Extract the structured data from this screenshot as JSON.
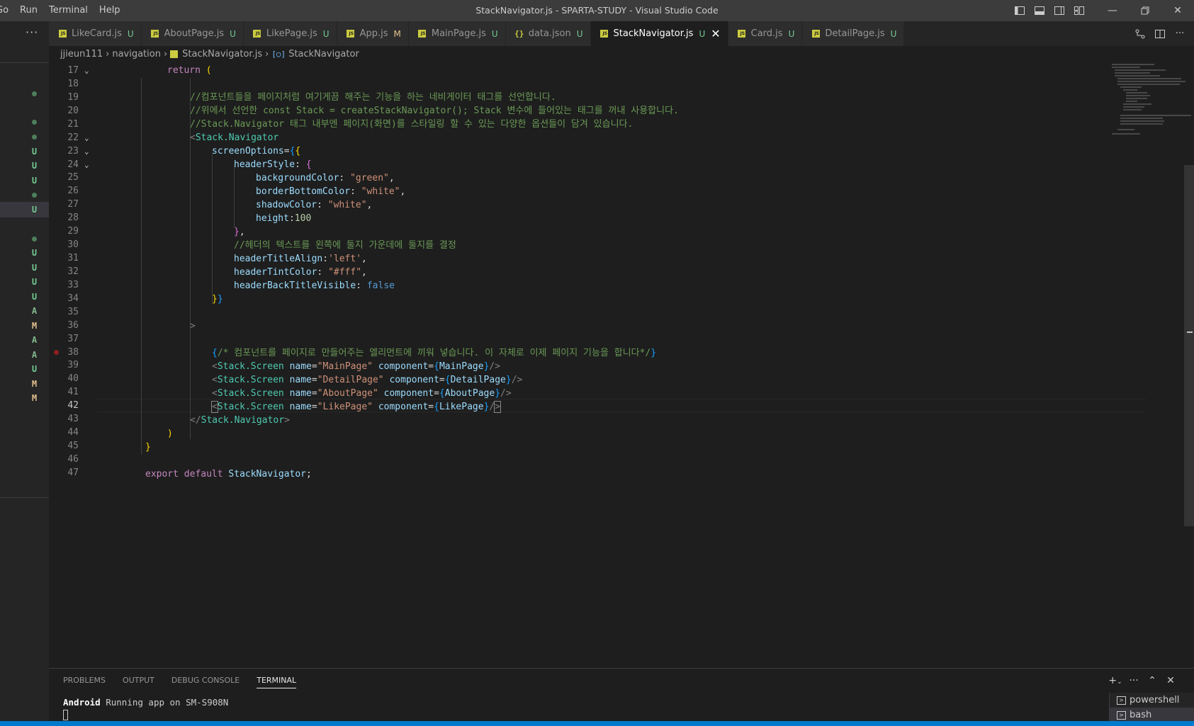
{
  "menu": [
    "Go",
    "Run",
    "Terminal",
    "Help"
  ],
  "window_title": "StackNavigator.js - SPARTA-STUDY - Visual Studio Code",
  "tabs": [
    {
      "label": "LikeCard.js",
      "status": "U",
      "icon": "js-icon"
    },
    {
      "label": "AboutPage.js",
      "status": "U",
      "icon": "js-icon"
    },
    {
      "label": "LikePage.js",
      "status": "U",
      "icon": "js-icon"
    },
    {
      "label": "App.js",
      "status": "M",
      "icon": "js-icon"
    },
    {
      "label": "MainPage.js",
      "status": "U",
      "icon": "js-icon"
    },
    {
      "label": "data.json",
      "status": "U",
      "icon": "json-icon"
    },
    {
      "label": "StackNavigator.js",
      "status": "U",
      "icon": "js-icon",
      "active": true
    },
    {
      "label": "Card.js",
      "status": "U",
      "icon": "js-icon"
    },
    {
      "label": "DetailPage.js",
      "status": "U",
      "icon": "js-icon"
    }
  ],
  "breadcrumb": {
    "root": "jjieun111",
    "folder": "navigation",
    "file": "StackNavigator.js",
    "symbol": "StackNavigator"
  },
  "scm_badges": [
    "dot",
    "dot",
    "dot",
    "U",
    "U",
    "U",
    "dot",
    "U",
    "dot",
    "U",
    "U",
    "U",
    "U",
    "A",
    "M",
    "A",
    "A",
    "U",
    "M",
    "M"
  ],
  "editor": {
    "current_line": 42,
    "breakpoint_line": 38,
    "lines": [
      {
        "n": "17",
        "fold": true
      },
      {
        "n": "18"
      },
      {
        "n": "19",
        "text": "//컴포넌트들을 페이지처럼 여기게끔 해주는 기능을 하는 네비게이터 태그를 선언합니다."
      },
      {
        "n": "20",
        "text": "//위에서 선언한 const Stack = createStackNavigator(); Stack 변수에 들어있는 태그를 꺼내 사용합니다."
      },
      {
        "n": "21",
        "text": "//Stack.Navigator 태그 내부엔 페이지(화면)를 스타일링 할 수 있는 다양한 옵션들이 담겨 있습니다."
      },
      {
        "n": "22",
        "fold": true
      },
      {
        "n": "23",
        "fold": true
      },
      {
        "n": "24",
        "fold": true
      },
      {
        "n": "25"
      },
      {
        "n": "26"
      },
      {
        "n": "27"
      },
      {
        "n": "28"
      },
      {
        "n": "29"
      },
      {
        "n": "30",
        "text": "//헤더의 텍스트를 왼쪽에 둘지 가운데에 둘지를 결정"
      },
      {
        "n": "31"
      },
      {
        "n": "32"
      },
      {
        "n": "33"
      },
      {
        "n": "34"
      },
      {
        "n": "35"
      },
      {
        "n": "36"
      },
      {
        "n": "37"
      },
      {
        "n": "38",
        "text": "/* 컴포넌트를 페이지로 만들어주는 엘리먼트에 끼워 넣습니다. 이 자체로 이제 페이지 기능을 합니다*/"
      },
      {
        "n": "39"
      },
      {
        "n": "40"
      },
      {
        "n": "41"
      },
      {
        "n": "42"
      },
      {
        "n": "43"
      },
      {
        "n": "44"
      },
      {
        "n": "45"
      },
      {
        "n": "46"
      },
      {
        "n": "47"
      }
    ],
    "tokens": {
      "return_kw": "return",
      "stack_navigator_tag": "Stack.Navigator",
      "screen_options": "screenOptions",
      "header_style": "headerStyle",
      "background_color_key": "backgroundColor",
      "background_color_val": "\"green\"",
      "border_bottom_color_key": "borderBottomColor",
      "border_bottom_color_val": "\"white\"",
      "shadow_color_key": "shadowColor",
      "shadow_color_val": "\"white\"",
      "height_key": "height",
      "height_val": "100",
      "header_title_align_key": "headerTitleAlign",
      "header_title_align_val": "'left'",
      "header_tint_color_key": "headerTintColor",
      "header_tint_color_val": "\"#fff\"",
      "header_back_title_visible_key": "headerBackTitleVisible",
      "header_back_title_visible_val": "false",
      "stack_screen_tag": "Stack.Screen",
      "name_attr": "name",
      "component_attr": "component",
      "screens": [
        {
          "name": "\"MainPage\"",
          "component": "MainPage"
        },
        {
          "name": "\"DetailPage\"",
          "component": "DetailPage"
        },
        {
          "name": "\"AboutPage\"",
          "component": "AboutPage"
        },
        {
          "name": "\"LikePage\"",
          "component": "LikePage"
        }
      ],
      "export_kw": "export",
      "default_kw": "default",
      "export_name": "StackNavigator"
    }
  },
  "panel": {
    "tabs": [
      "PROBLEMS",
      "OUTPUT",
      "DEBUG CONSOLE",
      "TERMINAL"
    ],
    "active_tab": "TERMINAL",
    "terminal_prefix": "Android",
    "terminal_text": " Running app on SM-S908N",
    "terminals": [
      "powershell",
      "bash"
    ]
  },
  "colors": {
    "accent": "#007acc",
    "untracked": "#73c991",
    "modified": "#e2c08d"
  }
}
